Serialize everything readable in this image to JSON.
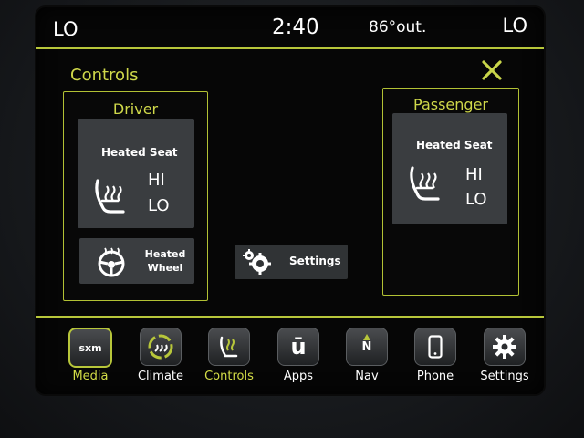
{
  "status": {
    "left_fan": "LO",
    "time": "2:40",
    "outside_temp": "86°out.",
    "right_fan": "LO"
  },
  "page": {
    "title": "Controls",
    "close_glyph": "✕"
  },
  "driver": {
    "title": "Driver",
    "heated_seat": {
      "label": "Heated Seat",
      "levels": [
        "HI",
        "LO"
      ]
    },
    "heated_wheel": {
      "line1": "Heated",
      "line2": "Wheel"
    }
  },
  "passenger": {
    "title": "Passenger",
    "heated_seat": {
      "label": "Heated Seat",
      "levels": [
        "HI",
        "LO"
      ]
    }
  },
  "settings_tile": {
    "label": "Settings"
  },
  "nav": [
    {
      "label": "Media",
      "icon": "sxm-icon",
      "icon_text": "sxm",
      "active": true
    },
    {
      "label": "Climate",
      "icon": "climate-icon",
      "active": false
    },
    {
      "label": "Controls",
      "icon": "controls-icon",
      "active": false
    },
    {
      "label": "Apps",
      "icon": "apps-icon",
      "icon_text": "ū",
      "active": false
    },
    {
      "label": "Nav",
      "icon": "compass-icon",
      "icon_text": "N",
      "active": false
    },
    {
      "label": "Phone",
      "icon": "phone-icon",
      "active": false
    },
    {
      "label": "Settings",
      "icon": "gear-icon",
      "active": false
    }
  ],
  "colors": {
    "accent": "#b7c63a",
    "text_accent": "#cfd84a",
    "tile": "#3a3d40",
    "background": "#060606"
  }
}
